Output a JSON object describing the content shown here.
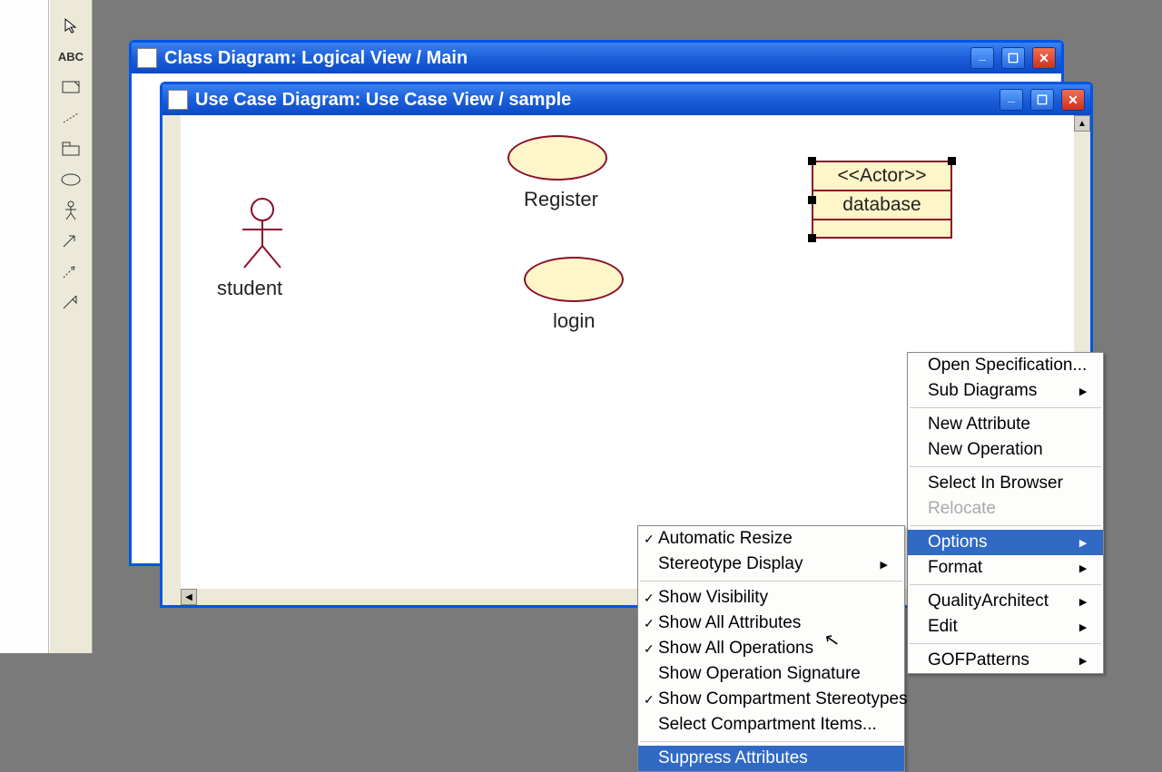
{
  "windows": {
    "class_diagram": {
      "title": "Class Diagram: Logical View / Main"
    },
    "usecase_diagram": {
      "title": "Use Case Diagram: Use Case View / sample"
    }
  },
  "usecases": {
    "register": "Register",
    "login": "login"
  },
  "actor_student": "student",
  "database_element": {
    "stereotype": "<<Actor>>",
    "name": "database"
  },
  "context_menu": {
    "open_spec": "Open Specification...",
    "sub_diagrams": "Sub Diagrams",
    "new_attribute": "New Attribute",
    "new_operation": "New Operation",
    "select_in_browser": "Select In Browser",
    "relocate": "Relocate",
    "options": "Options",
    "format": "Format",
    "quality_architect": "QualityArchitect",
    "edit": "Edit",
    "gof_patterns": "GOFPatterns"
  },
  "options_submenu": {
    "automatic_resize": "Automatic Resize",
    "stereotype_display": "Stereotype Display",
    "show_visibility": "Show Visibility",
    "show_all_attributes": "Show All Attributes",
    "show_all_operations": "Show All Operations",
    "show_op_signature": "Show Operation Signature",
    "show_compartment_stereo": "Show Compartment Stereotypes",
    "select_compartment_items": "Select Compartment Items...",
    "suppress_attributes": "Suppress Attributes"
  },
  "toolbox": {
    "pointer": "pointer",
    "text": "ABC",
    "package": "package",
    "line": "line",
    "folder": "folder",
    "ellipse": "ellipse",
    "actor": "actor",
    "dep1": "dep1",
    "dep2": "dep2",
    "dep3": "dep3"
  }
}
